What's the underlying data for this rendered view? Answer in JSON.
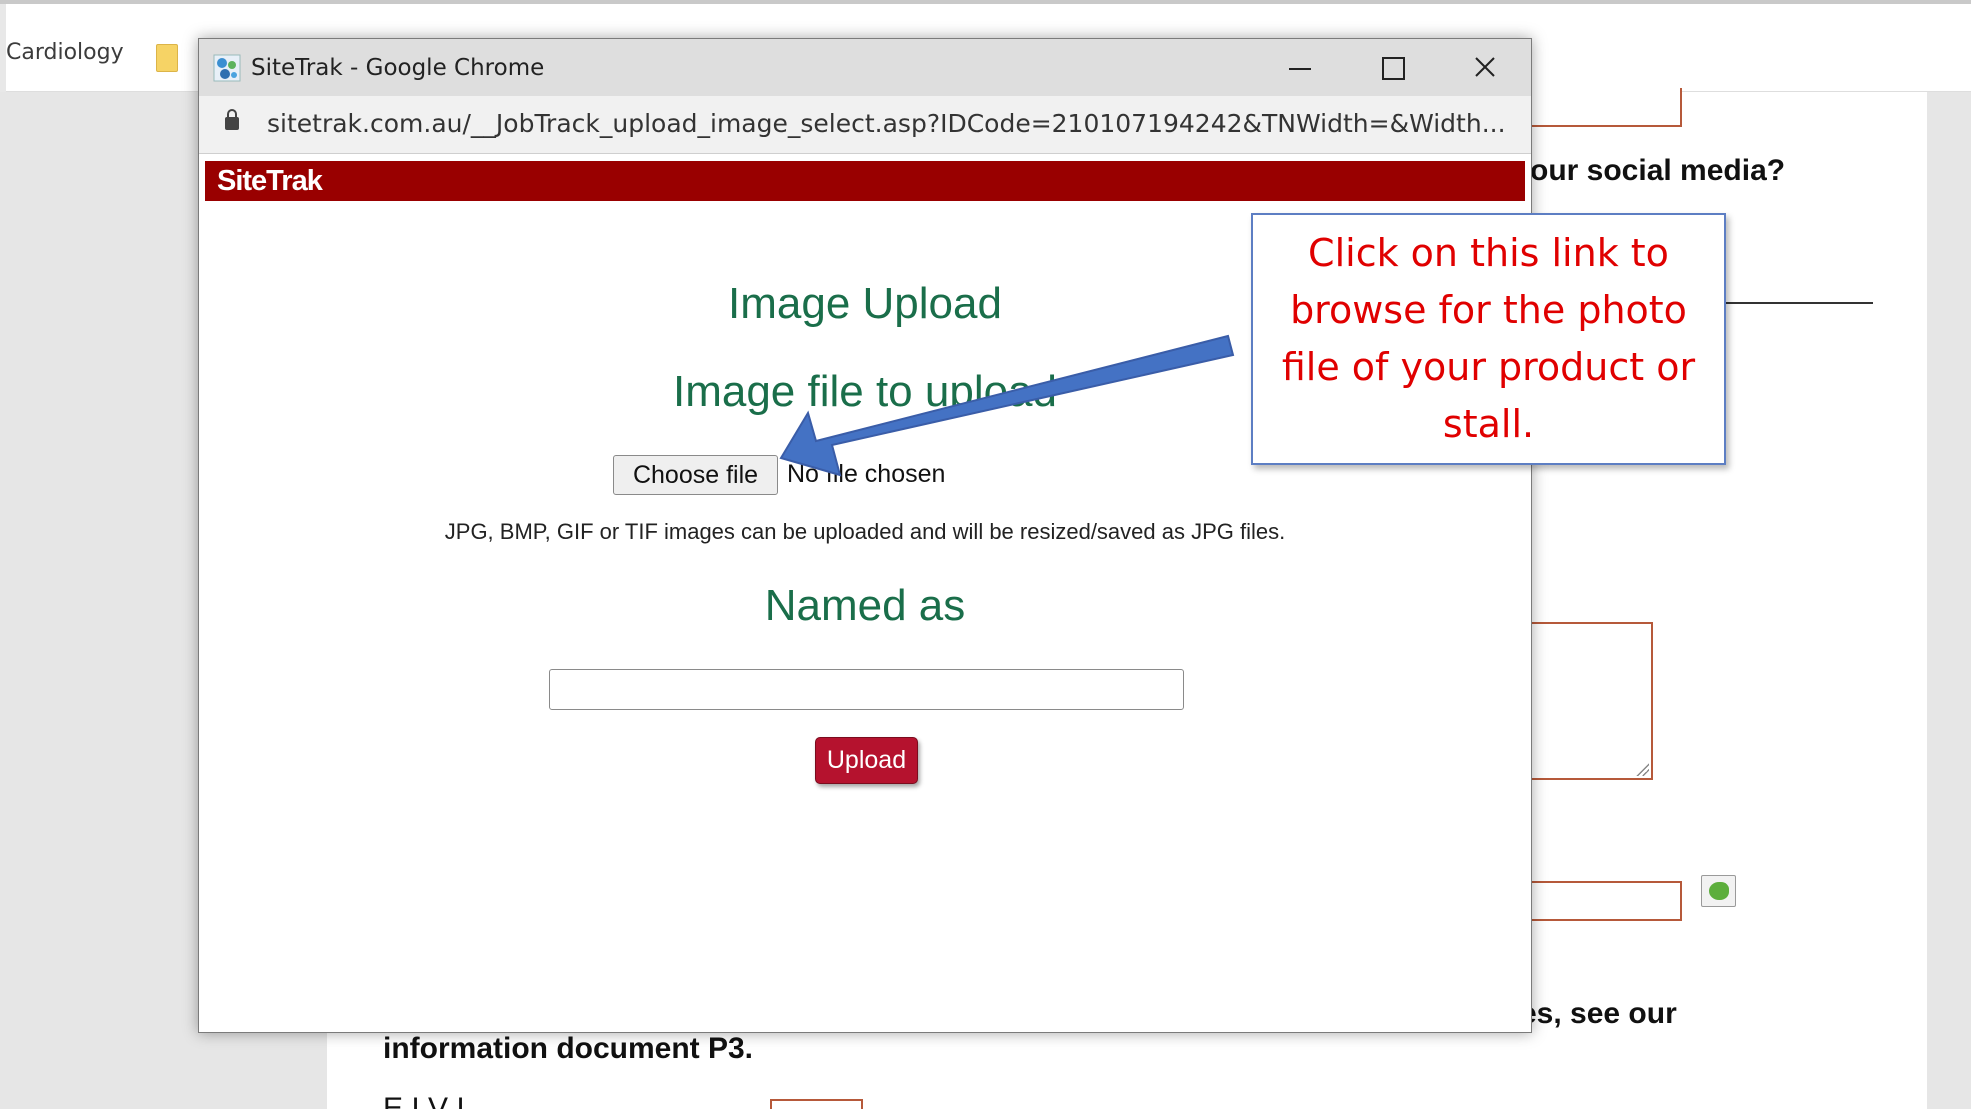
{
  "background": {
    "bookmark_label": "Cardiology",
    "social_text": "our social media?",
    "see_our_text": "es, see our",
    "info_doc_text": "information document P3.",
    "cut_label_text": "E    I V     I"
  },
  "window": {
    "title": "SiteTrak - Google Chrome",
    "url": "sitetrak.com.au/__JobTrack_upload_image_select.asp?IDCode=210107194242&TNWidth=&Width..."
  },
  "site": {
    "logo": "SiteTrak",
    "header_color": "#990000"
  },
  "form": {
    "heading": "Image Upload",
    "file_heading": "Image file to upload",
    "choose_file_label": "Choose file",
    "file_status": "No file chosen",
    "hint": "JPG, BMP, GIF or TIF images can be uploaded and will be resized/saved as JPG files.",
    "named_as_heading": "Named as",
    "named_as_value": "",
    "upload_label": "Upload"
  },
  "annotation": {
    "callout_text": "Click on this link to browse for the photo file of your product or stall.",
    "text_color": "#e00000",
    "arrow_color": "#4472c4"
  }
}
